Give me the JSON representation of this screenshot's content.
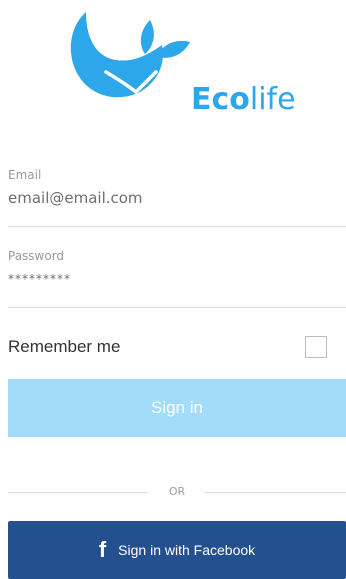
{
  "brand": {
    "name_bold": "Eco",
    "name_regular": "life",
    "accent_color": "#2ea7ea"
  },
  "form": {
    "email": {
      "label": "Email",
      "value": "email@email.com"
    },
    "password": {
      "label": "Password",
      "value": "*********"
    },
    "remember": {
      "label": "Remember me",
      "checked": false
    }
  },
  "actions": {
    "signin_label": "Sign in",
    "signin_color": "#a3dcfb",
    "separator_text": "OR",
    "facebook_label": "Sign in with Facebook",
    "facebook_icon": "f",
    "facebook_color": "#25508f"
  }
}
